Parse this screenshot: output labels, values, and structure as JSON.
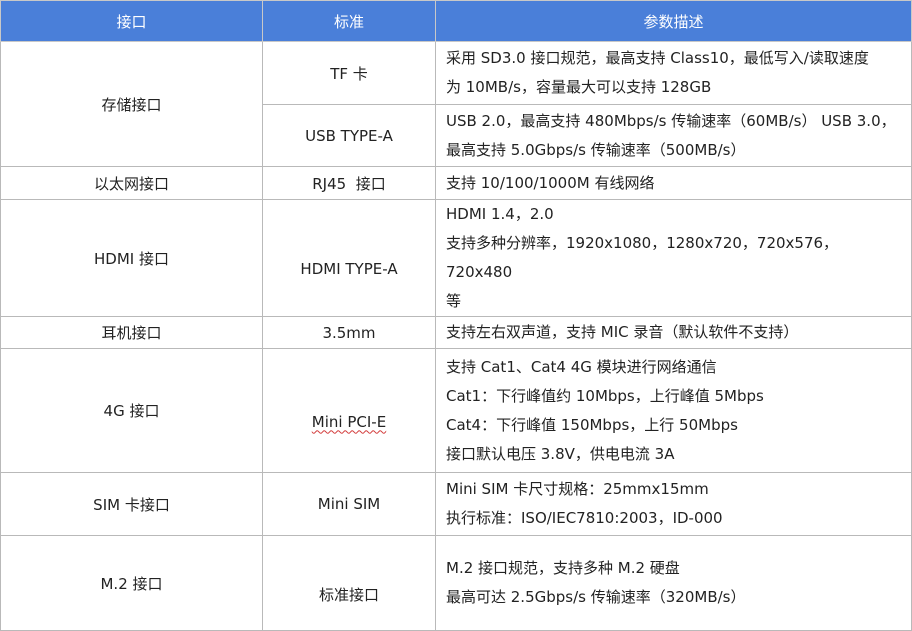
{
  "headers": [
    "接口",
    "标准",
    "参数描述"
  ],
  "rows": {
    "storage": {
      "interface": "存储接口",
      "tf_standard": "TF 卡",
      "tf_desc": [
        "采用 SD3.0 接口规范，最高支持 Class10，最低写入/读取速度",
        "为 10MB/s，容量最大可以支持 128GB"
      ],
      "usb_standard": "USB TYPE-A",
      "usb_desc": [
        "USB 2.0，最高支持 480Mbps/s 传输速率（60MB/s） USB 3.0，",
        "最高支持 5.0Gbps/s 传输速率（500MB/s）"
      ]
    },
    "ethernet": {
      "interface": "以太网接口",
      "standard": "RJ45  接口",
      "desc": [
        "支持 10/100/1000M 有线网络"
      ]
    },
    "hdmi": {
      "interface": "HDMI 接口",
      "standard": "HDMI TYPE-A",
      "desc": [
        "HDMI 1.4，2.0",
        "支持多种分辨率，1920x1080，1280x720，720x576，720x480",
        "等"
      ]
    },
    "headphone": {
      "interface": "耳机接口",
      "standard": "3.5mm",
      "desc": [
        "支持左右双声道，支持 MIC 录音（默认软件不支持）"
      ]
    },
    "lte": {
      "interface": "4G 接口",
      "standard": "Mini PCI-E",
      "desc": [
        "支持 Cat1、Cat4 4G 模块进行网络通信",
        "Cat1：下行峰值约 10Mbps，上行峰值 5Mbps",
        "Cat4：下行峰值 150Mbps，上行 50Mbps",
        "接口默认电压 3.8V，供电电流 3A"
      ]
    },
    "sim": {
      "interface": "SIM 卡接口",
      "standard": "Mini SIM",
      "desc": [
        "Mini SIM 卡尺寸规格：25mmx15mm",
        "执行标准：ISO/IEC7810:2003，ID-000"
      ]
    },
    "m2": {
      "interface": "M.2 接口",
      "standard": "标准接口",
      "desc": [
        "M.2 接口规范，支持多种 M.2 硬盘",
        "最高可达 2.5Gbps/s 传输速率（320MB/s）"
      ]
    }
  },
  "colors": {
    "header_bg": "#4a7fd9",
    "header_text": "#ffffff",
    "border": "#b9b9b9",
    "spellcheck_underline": "#d23a3a"
  }
}
